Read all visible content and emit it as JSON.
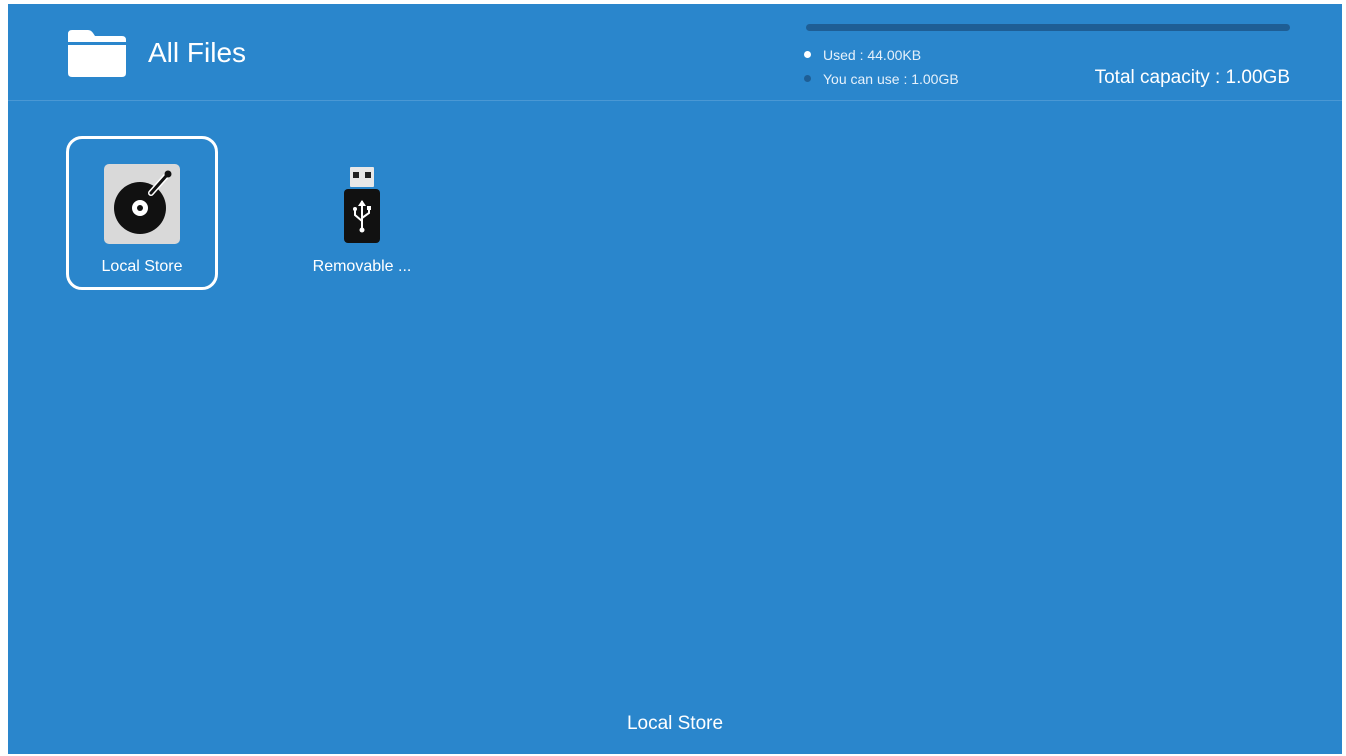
{
  "header": {
    "title": "All Files",
    "icon": "folder-icon"
  },
  "storage": {
    "used_label": "Used : 44.00KB",
    "available_label": "You can use : 1.00GB",
    "total_label": "Total capacity : 1.00GB",
    "used_fraction": 0.0,
    "colors": {
      "used": "#ffffff",
      "available": "#1e5e95"
    }
  },
  "tiles": [
    {
      "label": "Local Store",
      "icon": "hard-disk-icon",
      "selected": true
    },
    {
      "label": "Removable ...",
      "icon": "usb-drive-icon",
      "selected": false
    }
  ],
  "status": {
    "label": "Local Store"
  },
  "colors": {
    "background": "#2a86cc",
    "accent": "#ffffff"
  }
}
